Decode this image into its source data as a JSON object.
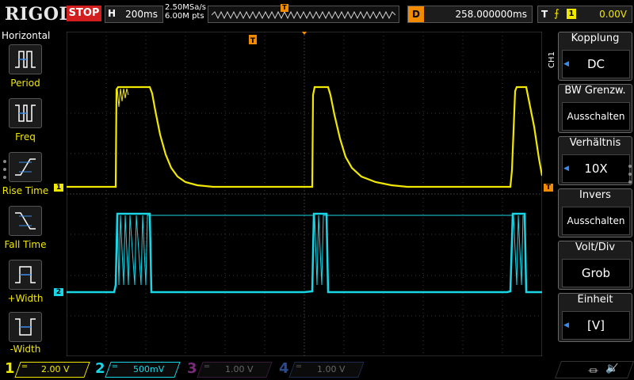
{
  "header": {
    "brand": "RIGOL",
    "run_state": "STOP",
    "timebase_label": "H",
    "timebase_value": "200ms",
    "sample_rate": "2.50MSa/s",
    "memory_depth": "6.00M pts",
    "trigger_pos_marker": "T",
    "delay_label": "D",
    "delay_value": "258.000000ms",
    "trigger_label": "T",
    "trigger_edge_icon": "rising-edge-icon",
    "trigger_source": "1",
    "trigger_level": "0.00V"
  },
  "left_panel": {
    "title": "Horizontal",
    "items": [
      {
        "label": "Period",
        "icon": "period-icon"
      },
      {
        "label": "Freq",
        "icon": "frequency-icon"
      },
      {
        "label": "Rise Time",
        "icon": "rise-time-icon"
      },
      {
        "label": "Fall Time",
        "icon": "fall-time-icon"
      },
      {
        "label": "+Width",
        "icon": "positive-width-icon"
      },
      {
        "label": "-Width",
        "icon": "negative-width-icon"
      }
    ]
  },
  "right_panel": {
    "channel_tag": "CH1",
    "items": [
      {
        "header": "Kopplung",
        "value": "DC"
      },
      {
        "header": "BW Grenzw.",
        "value": "Ausschalten"
      },
      {
        "header": "Verhältnis",
        "value": "10X"
      },
      {
        "header": "Invers",
        "value": "Ausschalten"
      },
      {
        "header": "Volt/Div",
        "value": "Grob"
      },
      {
        "header": "Einheit",
        "value": "[V]"
      }
    ]
  },
  "graticule": {
    "ch1_marker": "1",
    "ch2_marker": "2",
    "trigger_top_marker": "T",
    "trigger_level_marker": "T"
  },
  "channels": [
    {
      "num": "1",
      "scale": "2.00 V",
      "color": "#f1e800",
      "active": true
    },
    {
      "num": "2",
      "scale": "500mV",
      "color": "#18d6e6",
      "active": true
    },
    {
      "num": "3",
      "scale": "1.00 V",
      "color": "#c03ac0",
      "active": false
    },
    {
      "num": "4",
      "scale": "1.00 V",
      "color": "#2f6fd6",
      "active": false
    }
  ],
  "status_icons": [
    "usb-icon",
    "speaker-mute-icon"
  ],
  "colors": {
    "ch1": "#f1e800",
    "ch2": "#18d6e6",
    "accent_stop": "#d21e1e",
    "trigger": "#f28b00",
    "menu_arrow": "#3c8ce7"
  }
}
